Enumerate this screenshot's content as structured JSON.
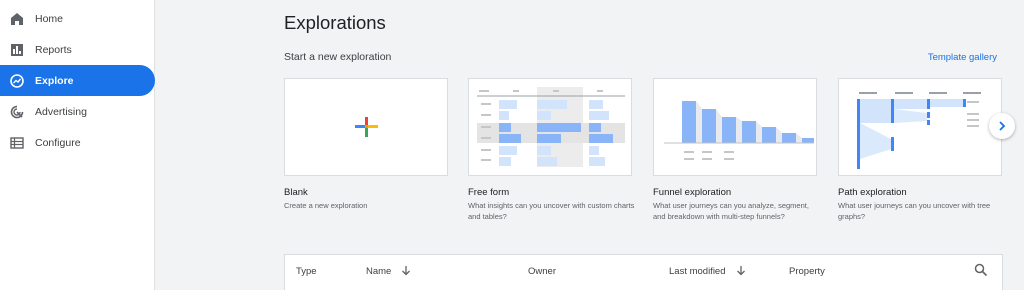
{
  "sidebar": {
    "items": [
      {
        "label": "Home",
        "icon": "home-icon"
      },
      {
        "label": "Reports",
        "icon": "bar-chart-icon"
      },
      {
        "label": "Explore",
        "icon": "explore-icon",
        "active": true
      },
      {
        "label": "Advertising",
        "icon": "advertising-icon"
      },
      {
        "label": "Configure",
        "icon": "configure-list-icon"
      }
    ],
    "active_color": "#1a73e8"
  },
  "main": {
    "title": "Explorations",
    "section_title": "Start a new exploration",
    "template_gallery_label": "Template gallery",
    "cards": [
      {
        "title": "Blank",
        "description": "Create a new exploration"
      },
      {
        "title": "Free form",
        "description": "What insights can you uncover with custom charts and tables?"
      },
      {
        "title": "Funnel exploration",
        "description": "What user journeys can you analyze, segment, and breakdown with multi-step funnels?"
      },
      {
        "title": "Path exploration",
        "description": "What user journeys can you uncover with tree graphs?"
      }
    ],
    "next_icon": "chevron-right-icon"
  },
  "table": {
    "columns": [
      "Type",
      "Name",
      "Owner",
      "Last modified",
      "Property"
    ],
    "search_icon": "search-icon"
  },
  "colors": {
    "accent": "#1a73e8",
    "chart_blue": "#8ab4f8",
    "chart_light": "#d2e3fc"
  }
}
